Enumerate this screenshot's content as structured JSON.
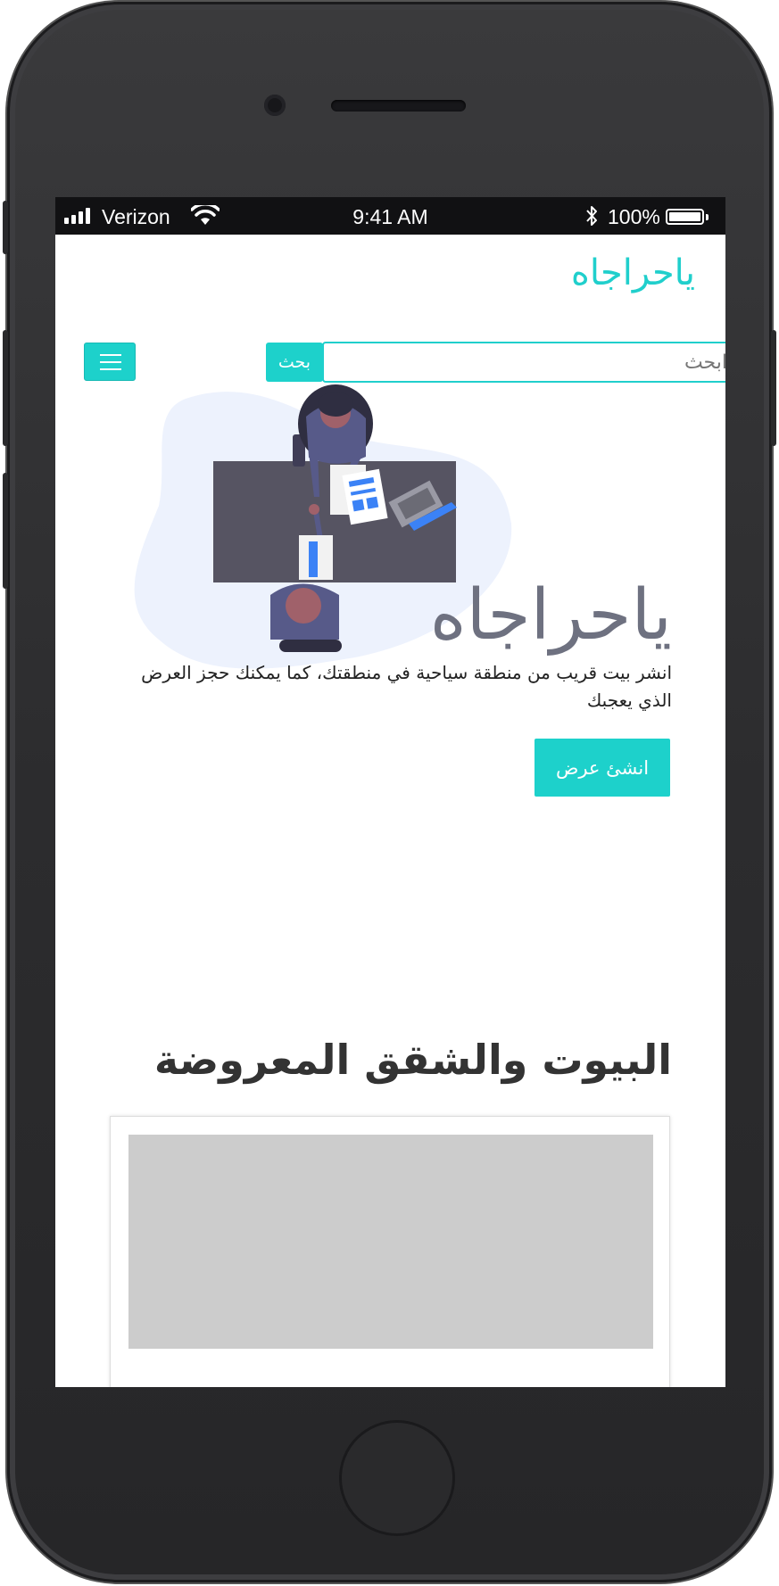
{
  "status_bar": {
    "carrier": "Verizon",
    "time": "9:41 AM",
    "battery_percent": "100%"
  },
  "header": {
    "brand": "ياحراجاه",
    "search": {
      "placeholder": "ابحث",
      "button_label": "بحث"
    },
    "menu_icon": "hamburger-icon"
  },
  "hero": {
    "title": "ياحراجاه",
    "description": "انشر بيت قريب من منطقة سياحية في منطقتك، كما يمكنك حجز العرض الذي يعجبك",
    "cta_label": "انشئ عرض"
  },
  "listings": {
    "section_title": "البيوت والشقق المعروضة"
  },
  "colors": {
    "accent": "#1dd1cb",
    "hero_title": "#6e7180",
    "image_placeholder": "#cccccc"
  }
}
